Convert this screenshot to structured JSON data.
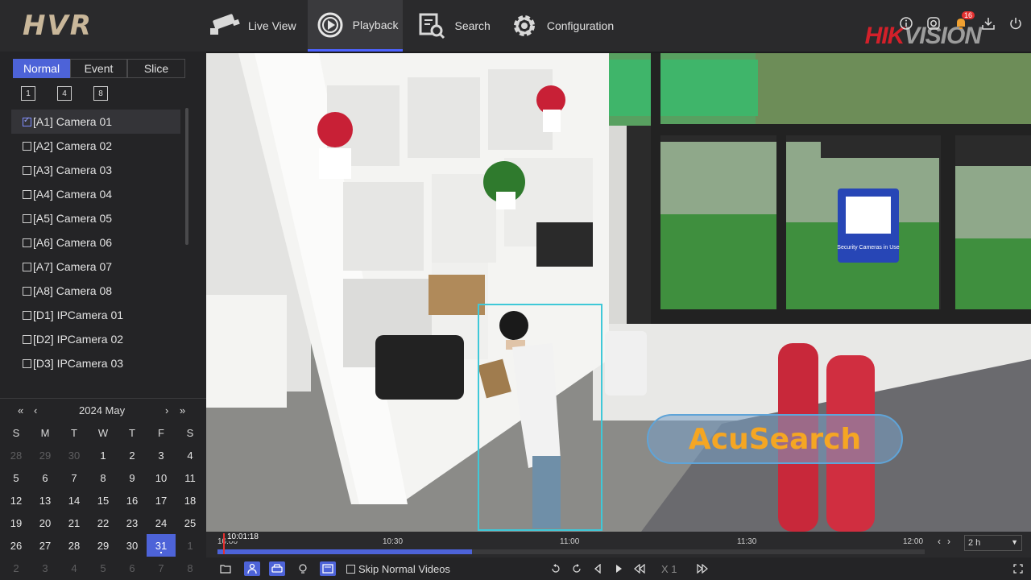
{
  "app": {
    "logo": "HVR",
    "brand_a": "HIK",
    "brand_b": "VISION",
    "notification_count": "16"
  },
  "nav": [
    {
      "label": "Live View",
      "icon": "camera-icon"
    },
    {
      "label": "Playback",
      "icon": "play-circle-icon"
    },
    {
      "label": "Search",
      "icon": "search-doc-icon"
    },
    {
      "label": "Configuration",
      "icon": "gear-icon"
    }
  ],
  "tabs": [
    "Normal",
    "Event",
    "Slice"
  ],
  "layout_buttons": [
    "1",
    "4",
    "8"
  ],
  "cameras": [
    "[A1] Camera 01",
    "[A2] Camera 02",
    "[A3] Camera 03",
    "[A4] Camera 04",
    "[A5] Camera 05",
    "[A6] Camera 06",
    "[A7] Camera 07",
    "[A8] Camera 08",
    "[D1] IPCamera 01",
    "[D2] IPCamera 02",
    "[D3] IPCamera 03"
  ],
  "calendar": {
    "title": "2024 May",
    "prev_year": "«",
    "prev_month": "‹",
    "next_month": "›",
    "next_year": "»",
    "weekdays": [
      "S",
      "M",
      "T",
      "W",
      "T",
      "F",
      "S"
    ],
    "days": [
      "28",
      "29",
      "30",
      "1",
      "2",
      "3",
      "4",
      "5",
      "6",
      "7",
      "8",
      "9",
      "10",
      "11",
      "12",
      "13",
      "14",
      "15",
      "16",
      "17",
      "18",
      "19",
      "20",
      "21",
      "22",
      "23",
      "24",
      "25",
      "26",
      "27",
      "28",
      "29",
      "30",
      "31",
      "1",
      "2",
      "3",
      "4",
      "5",
      "6",
      "7",
      "8"
    ],
    "selected": "31"
  },
  "video": {
    "overlay_text": "AcuSearch",
    "sign_text": "Security Cameras in Use"
  },
  "timeline": {
    "current_time": "10:01:18",
    "labels": [
      "10:00",
      "10:30",
      "11:00",
      "11:30",
      "12:00"
    ],
    "zoom": "2 h",
    "progress": 0.36
  },
  "toolbar": {
    "skip_label": "Skip Normal Videos",
    "speed": "X 1"
  },
  "colors": {
    "accent": "#4d63d8",
    "detection_box": "#3fc8d8",
    "acusearch_text": "#f5a623",
    "brand_red": "#d3202a"
  }
}
